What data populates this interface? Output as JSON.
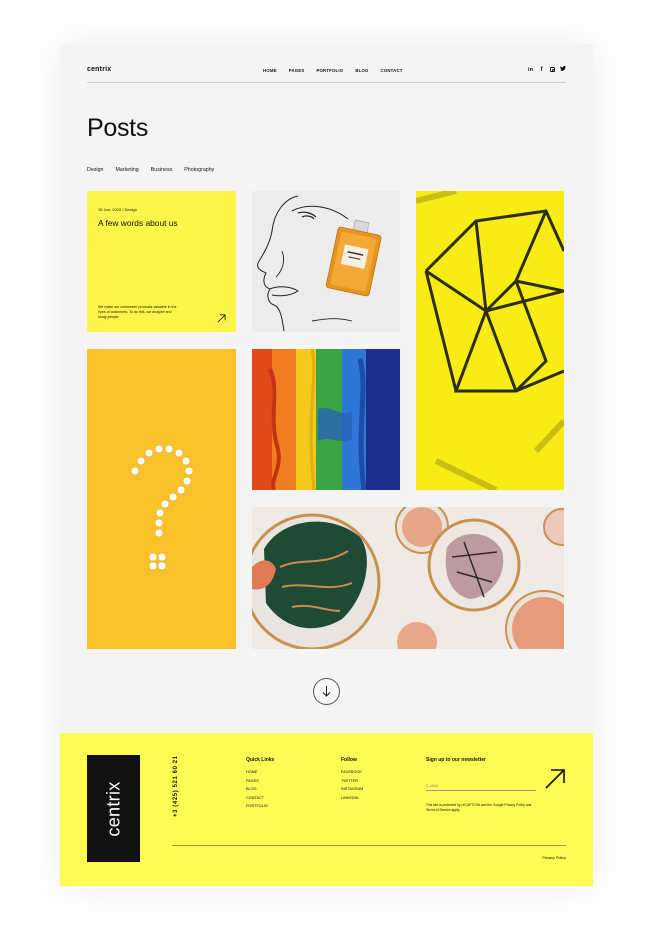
{
  "header": {
    "logo": "centrix",
    "nav": [
      "HOME",
      "PAGES",
      "PORTFOLIO",
      "BLOG",
      "CONTACT"
    ],
    "social_icons": [
      "linkedin-icon",
      "facebook-icon",
      "instagram-icon",
      "twitter-icon"
    ]
  },
  "page": {
    "title": "Posts",
    "categories": [
      "Design",
      "Marketing",
      "Business",
      "Photography"
    ]
  },
  "about_card": {
    "meta": "15 Jun, 2020 / Design",
    "heading": "A few words about us",
    "description": "We make our customers’ products valuable in the eyes of customers. To do this, we analyze and study people."
  },
  "footer": {
    "logo": "centrix",
    "phone": "+3 (425) 521 60 21",
    "quick_links": {
      "title": "Quick Links",
      "items": [
        "HOME",
        "PAGES",
        "BLOG",
        "CONTACT",
        "PORTFOLIO"
      ]
    },
    "follow": {
      "title": "Follow",
      "items": [
        "FACEBOOK",
        "TWITTER",
        "INSTAGRAM",
        "LINKEDIN"
      ]
    },
    "newsletter": {
      "title": "Sign up to our newsletter",
      "email_placeholder": "E-MAIL",
      "recaptcha_note": "This site is protected by reCAPTCHA and the Google Privacy Policy and Terms of Service apply."
    },
    "privacy": "Privacy Policy"
  },
  "colors": {
    "accent_yellow": "#fdfc55",
    "tile_yellow": "#fdf54a",
    "page_bg": "#f4f4f4"
  }
}
